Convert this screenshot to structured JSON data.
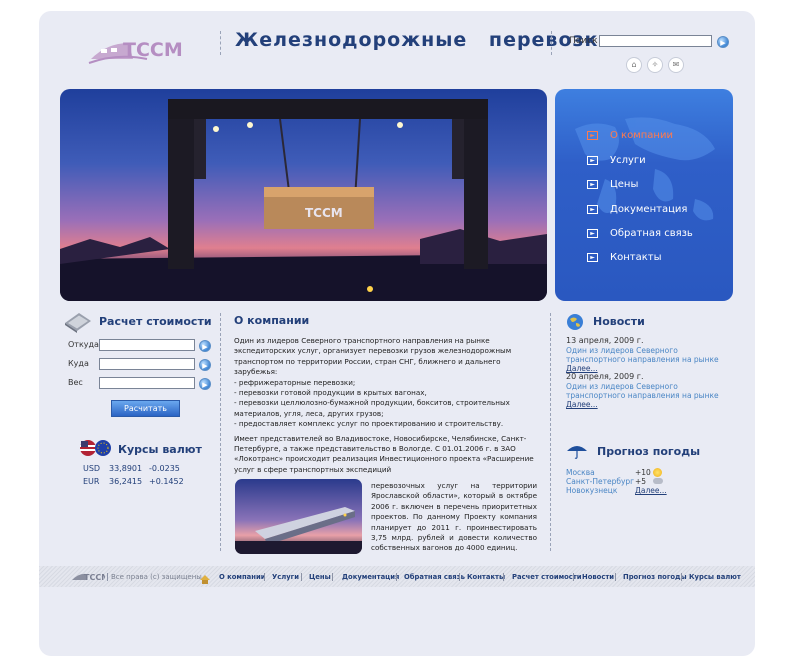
{
  "header": {
    "logo_text": "TCCM",
    "site_title": "Железнодорожные перевозки",
    "search_label": "Поиск",
    "search_value": "",
    "icons": [
      "home-icon",
      "sitemap-icon",
      "mail-icon"
    ]
  },
  "nav": {
    "items": [
      {
        "label": "О компании",
        "active": true
      },
      {
        "label": "Услуги"
      },
      {
        "label": "Цены"
      },
      {
        "label": "Документация"
      },
      {
        "label": "Обратная связь"
      },
      {
        "label": "Контакты"
      }
    ]
  },
  "calc": {
    "title": "Расчет стоимости",
    "from_label": "Откуда",
    "to_label": "Куда",
    "weight_label": "Вес",
    "button_label": "Расчитать"
  },
  "rates": {
    "title": "Курсы валют",
    "rows": [
      {
        "code": "USD",
        "value": "33,8901",
        "change": "-0.0235"
      },
      {
        "code": "EUR",
        "value": "36,2415",
        "change": "+0.1452"
      }
    ]
  },
  "about": {
    "title": "О компании",
    "p1": "Один из лидеров Северного транспортного направления  на рынке экспедиторских услуг, организует перевозки грузов железнодорожным транспортом по территории России, стран СНГ, ближнего и дальнего зарубежья:",
    "list": [
      "- рефрижераторные перевозки;",
      "- перевозки готовой продукции в крытых вагонах,",
      "- перевозки целлюлозно-бумажной продукции, бокситов, строительных материалов, угля, леса, других грузов;",
      "- предоставляет комплекс услуг по проектированию и строительству."
    ],
    "p2": "Имеет представителей во Владивостоке, Новосибирске, Челябинске, Санкт-Петербурге, а также представительство в Вологде. С 01.01.2006 г. в ЗАО «Локотранс» происходит реализация Инвестиционного проекта «Расширение услуг в сфере транспортных экспедиций",
    "p3": "перевозочных услуг на территории Ярославской области», который в октябре 2006 г. включен в перечень приоритетных проектов. По данному Проекту компания планирует до 2011 г. проинвестировать 3,75 млрд. рублей и довести количество собственных вагонов до 4000 единиц."
  },
  "news": {
    "title": "Новости",
    "items": [
      {
        "date": "13 апреля, 2009 г.",
        "text": "Один из лидеров Северного транспортного направления  на рынке",
        "more": "Далее..."
      },
      {
        "date": "20 апреля, 2009 г.",
        "text": "Один из лидеров Северного транспортного направления  на рынке",
        "more": "Далее..."
      }
    ]
  },
  "weather": {
    "title": "Прогноз погоды",
    "rows": [
      {
        "city": "Москва",
        "temp": "+10",
        "icon": "sun-icon"
      },
      {
        "city": "Санкт-Петербург",
        "temp": "+5",
        "icon": "cloud-icon"
      },
      {
        "city": "Новокузнецк",
        "temp": "",
        "icon": ""
      }
    ],
    "more": "Далее..."
  },
  "footer": {
    "copyright": "Все права (с) защищены",
    "links": [
      "О компании",
      "Услуги",
      "Цены",
      "Документация",
      "Обратная связь",
      "Контакты",
      "Расчет стоимости",
      "Новости",
      "Прогноз погоды",
      "Курсы валют"
    ]
  },
  "colors": {
    "accent": "#23407a",
    "link": "#4a86c5",
    "active_nav": "#ff7a4d",
    "nav_bg": "#2f5fc8"
  }
}
